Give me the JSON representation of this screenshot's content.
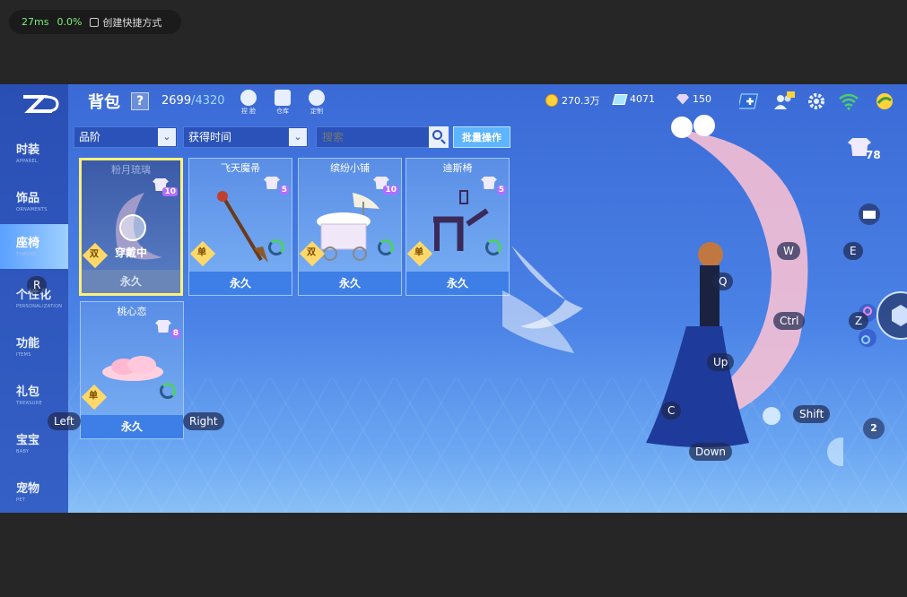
{
  "perf": {
    "ms": "27ms",
    "pct": "0.0%",
    "shortcut": "创建快捷方式"
  },
  "sidebar": {
    "items": [
      {
        "cn": "时装",
        "en": "APPAREL"
      },
      {
        "cn": "饰品",
        "en": "ORNAMENTS"
      },
      {
        "cn": "座椅",
        "en": "THRONE"
      },
      {
        "cn": "个性化",
        "en": "PERSONALIZATION"
      },
      {
        "cn": "功能",
        "en": "ITEMS"
      },
      {
        "cn": "礼包",
        "en": "TREASURE"
      },
      {
        "cn": "宝宝",
        "en": "BABY"
      },
      {
        "cn": "宠物",
        "en": "PET"
      }
    ],
    "active_index": 2
  },
  "header": {
    "title": "背包",
    "help": "?",
    "count": "2699",
    "capacity": "/4320",
    "icons": [
      {
        "name": "dye-icon",
        "label": "捏 脸"
      },
      {
        "name": "warehouse-icon",
        "label": "仓库"
      },
      {
        "name": "custom-icon",
        "label": "定制"
      }
    ],
    "currencies": {
      "gold": "270.3万",
      "tickets": "4071",
      "diamonds": "150"
    }
  },
  "filters": {
    "grade": "品阶",
    "sort": "获得时间",
    "search_placeholder": "搜索",
    "batch": "批量操作"
  },
  "items": [
    {
      "name": "粉月琉璃",
      "level": "10",
      "type": "双",
      "duration": "永久",
      "equipped": true,
      "equipped_label": "穿戴中"
    },
    {
      "name": "飞天魔帚",
      "level": "5",
      "type": "单",
      "duration": "永久",
      "equipped": false
    },
    {
      "name": "缤纷小铺",
      "level": "10",
      "type": "双",
      "duration": "永久",
      "equipped": false
    },
    {
      "name": "迪斯椅",
      "level": "5",
      "type": "单",
      "duration": "永久",
      "equipped": false
    },
    {
      "name": "桃心恋",
      "level": "8",
      "type": "单",
      "duration": "永久",
      "equipped": false
    }
  ],
  "keyhints": {
    "r": "R",
    "left": "Left",
    "right": "Right",
    "w": "W",
    "e": "E",
    "q": "Q",
    "ctrl": "Ctrl",
    "z": "Z",
    "up": "Up",
    "c": "C",
    "shift": "Shift",
    "down": "Down"
  },
  "wardrobe_level": "78",
  "side_badge": "2"
}
